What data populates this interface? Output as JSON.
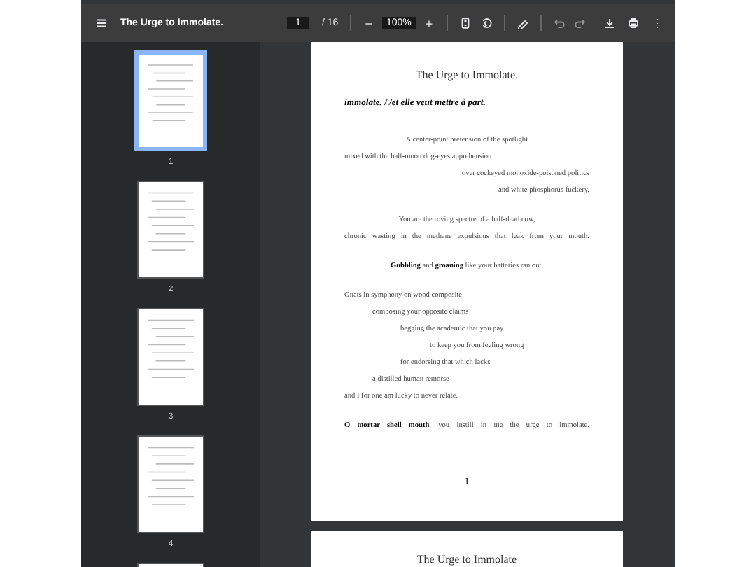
{
  "toolbar": {
    "title": "The Urge to Immolate.",
    "page_input": "1",
    "page_total": "/ 16",
    "zoom_minus": "−",
    "zoom": "100%",
    "zoom_plus": "+"
  },
  "thumbnails": [
    {
      "label": "1",
      "selected": true
    },
    {
      "label": "2",
      "selected": false
    },
    {
      "label": "3",
      "selected": false
    },
    {
      "label": "4",
      "selected": false
    },
    {
      "selected": false
    }
  ],
  "page": {
    "title": "The Urge to Immolate.",
    "heading": "immolate. / /et elle veut mettre à part.",
    "stanzas": [
      [
        {
          "kind": "center",
          "text": "A center-point pretension of the spotlight"
        },
        {
          "kind": "left",
          "text": "mixed with the half-moon dog-eyes apprehension"
        },
        {
          "kind": "right",
          "text": "over cockeyed monoxide-poisoned politics"
        },
        {
          "kind": "right",
          "text": "and white phosphorus fuckery."
        }
      ],
      [
        {
          "kind": "center",
          "text": "You are the roving spectre of a half-dead cow,"
        },
        {
          "kind": "justify",
          "text": "chronic wasting in the methane expulsions that leak from your mouth."
        }
      ],
      [
        {
          "kind": "center",
          "text": "**Gubbling** and **groaning** like your batteries ran out."
        }
      ],
      [
        {
          "kind": "left",
          "text": "Gnats in symphony on wood composite"
        },
        {
          "kind": "step1",
          "text": "composing your opposite claims"
        },
        {
          "kind": "step2",
          "text": "begging the academic that you pay"
        },
        {
          "kind": "step3",
          "text": "to keep you from feeling wrong"
        },
        {
          "kind": "step2",
          "text": "for endorsing that which lacks"
        },
        {
          "kind": "step1",
          "text": "a distilled human remorse"
        },
        {
          "kind": "left",
          "text": "and I for one am lucky to never relate."
        }
      ],
      [
        {
          "kind": "justify",
          "text": "**O mortar shell mouth**, you instill in me the urge to immolate."
        }
      ]
    ],
    "page_number": "1"
  },
  "next_page": {
    "title": "The Urge to Immolate"
  }
}
